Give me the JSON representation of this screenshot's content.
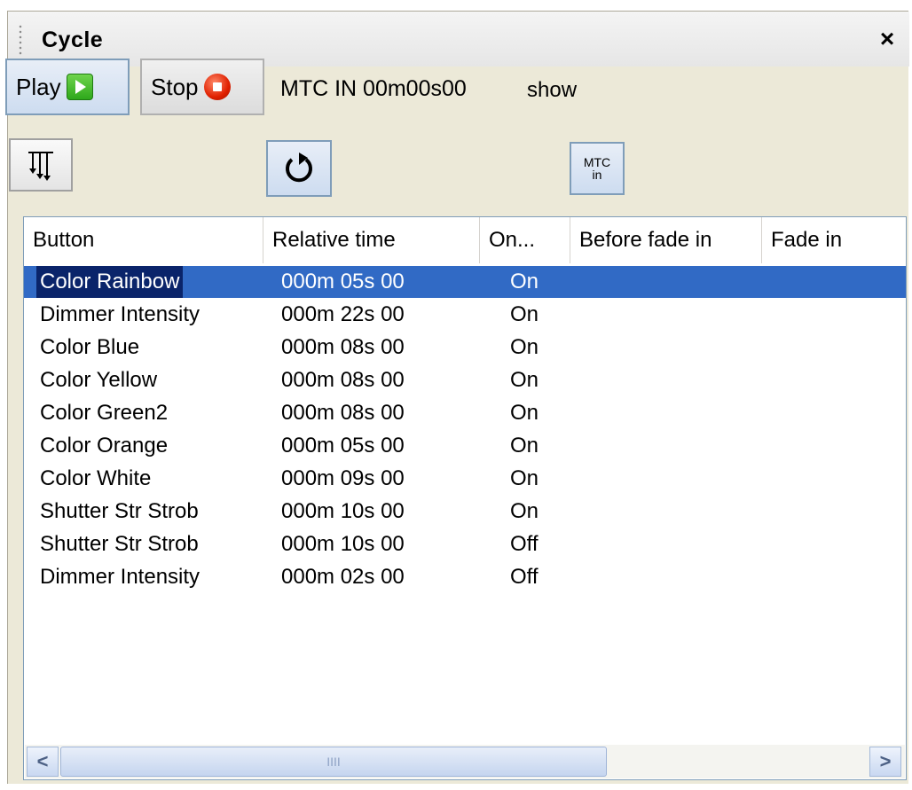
{
  "panel": {
    "title": "Cycle",
    "close_glyph": "×"
  },
  "toolbar": {
    "play_label": "Play",
    "stop_label": "Stop",
    "mtc_status": "MTC IN 00m00s00",
    "show_label": "show",
    "sort_icon": "sort-order-icon",
    "loop_icon": "loop-icon",
    "mtc_in_line1": "MTC",
    "mtc_in_line2": "in"
  },
  "table": {
    "columns": [
      "Button",
      "Relative time",
      "On...",
      "Before fade in",
      "Fade in"
    ],
    "rows": [
      {
        "button": "Color  Rainbow",
        "time": "000m 05s 00",
        "on": "On",
        "selected": true
      },
      {
        "button": "Dimmer Intensity",
        "time": "000m 22s 00",
        "on": "On"
      },
      {
        "button": "Color Blue",
        "time": "000m 08s 00",
        "on": "On"
      },
      {
        "button": "Color Yellow",
        "time": "000m 08s 00",
        "on": "On"
      },
      {
        "button": "Color Green2",
        "time": "000m 08s 00",
        "on": "On"
      },
      {
        "button": "Color Orange",
        "time": "000m 05s 00",
        "on": "On"
      },
      {
        "button": "Color White",
        "time": "000m 09s 00",
        "on": "On"
      },
      {
        "button": "Shutter Str Strob",
        "time": "000m 10s 00",
        "on": "On"
      },
      {
        "button": "Shutter Str Strob",
        "time": "000m 10s 00",
        "on": "Off"
      },
      {
        "button": "Dimmer Intensity",
        "time": "000m 02s 00",
        "on": "Off"
      }
    ]
  },
  "scrollbar": {
    "left_arrow": "<",
    "right_arrow": ">",
    "thumb_grip": "IIII"
  },
  "colors": {
    "selection": "#316ac5",
    "panel_bg": "#ece9d8",
    "border": "#7f9db9"
  }
}
